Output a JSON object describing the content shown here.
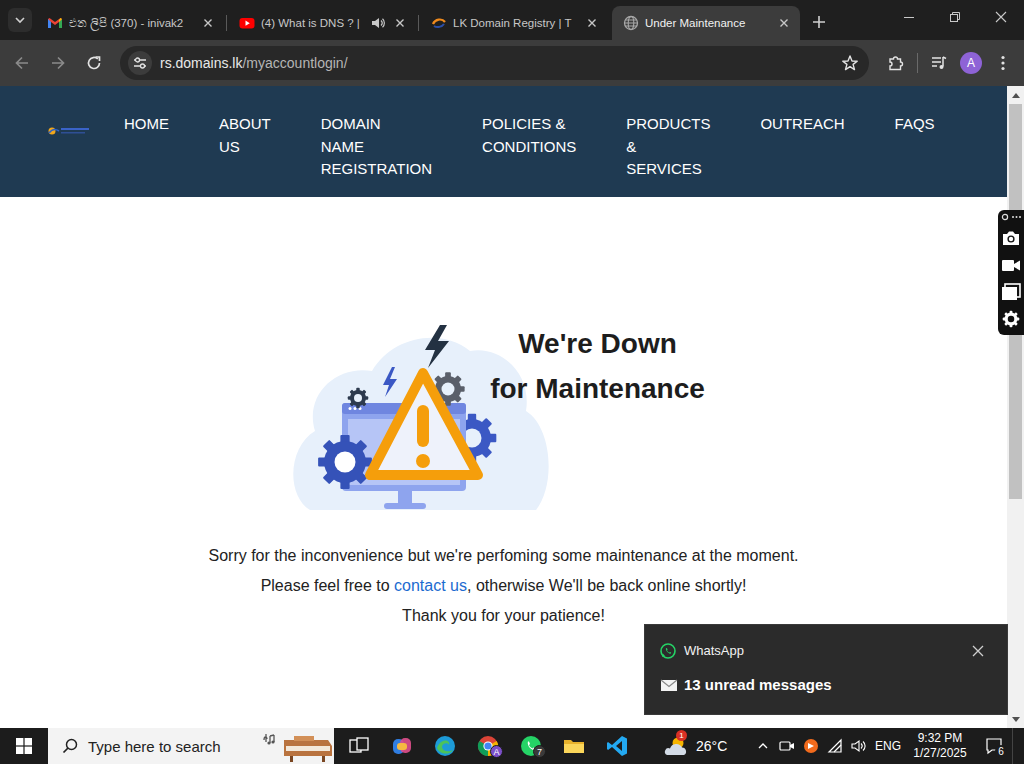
{
  "browser": {
    "tabs": [
      {
        "label": "එන ලිපි (370) - inivak2",
        "selected": false,
        "kind": "gmail",
        "audio": false
      },
      {
        "label": "(4) What is DNS ? |",
        "selected": false,
        "kind": "youtube",
        "audio": true
      },
      {
        "label": "LK Domain Registry | T",
        "selected": false,
        "kind": "registry",
        "audio": false
      },
      {
        "label": "Under Maintenance",
        "selected": true,
        "kind": "globe",
        "audio": false
      }
    ],
    "address": {
      "host": "rs.domains.lk",
      "path": "/myaccountlogin/"
    },
    "profile": "A"
  },
  "page": {
    "nav": [
      {
        "lines": [
          "HOME"
        ]
      },
      {
        "lines": [
          "ABOUT",
          "US"
        ]
      },
      {
        "lines": [
          "DOMAIN",
          "NAME",
          "REGISTRATION"
        ]
      },
      {
        "lines": [
          "POLICIES &",
          "CONDITIONS"
        ]
      },
      {
        "lines": [
          "PRODUCTS",
          "&",
          "SERVICES"
        ]
      },
      {
        "lines": [
          "OUTREACH"
        ]
      },
      {
        "lines": [
          "FAQS"
        ]
      }
    ],
    "heading": [
      "We're Down",
      "for Maintenance"
    ],
    "message": {
      "line1": "Sorry for the inconvenience but we're perfoming some maintenance at the moment.",
      "line2_before": "Please feel free to ",
      "link": "contact us",
      "line2_after": ", otherwise We'll be back online shortly!",
      "line3": "Thank you for your patience!"
    },
    "scrollbar": {
      "level": 0.65
    }
  },
  "notification": {
    "app": "WhatsApp",
    "message": "13 unread messages"
  },
  "taskbar": {
    "search_placeholder": "Type here to search",
    "apps": [
      {
        "kind": "taskview",
        "badge": ""
      },
      {
        "kind": "copilot",
        "badge": ""
      },
      {
        "kind": "edge",
        "badge": ""
      },
      {
        "kind": "chrome",
        "badge": "A",
        "color": "#7b4fc9"
      },
      {
        "kind": "whatsapp",
        "badge": "7",
        "color": "#3a3a3a"
      },
      {
        "kind": "explorer",
        "badge": ""
      },
      {
        "kind": "vscode",
        "badge": ""
      }
    ],
    "weather": {
      "temperature": "26°C",
      "badge": "1"
    },
    "language": "ENG",
    "time": "9:32 PM",
    "date": "1/27/2025",
    "notifications": "6"
  }
}
